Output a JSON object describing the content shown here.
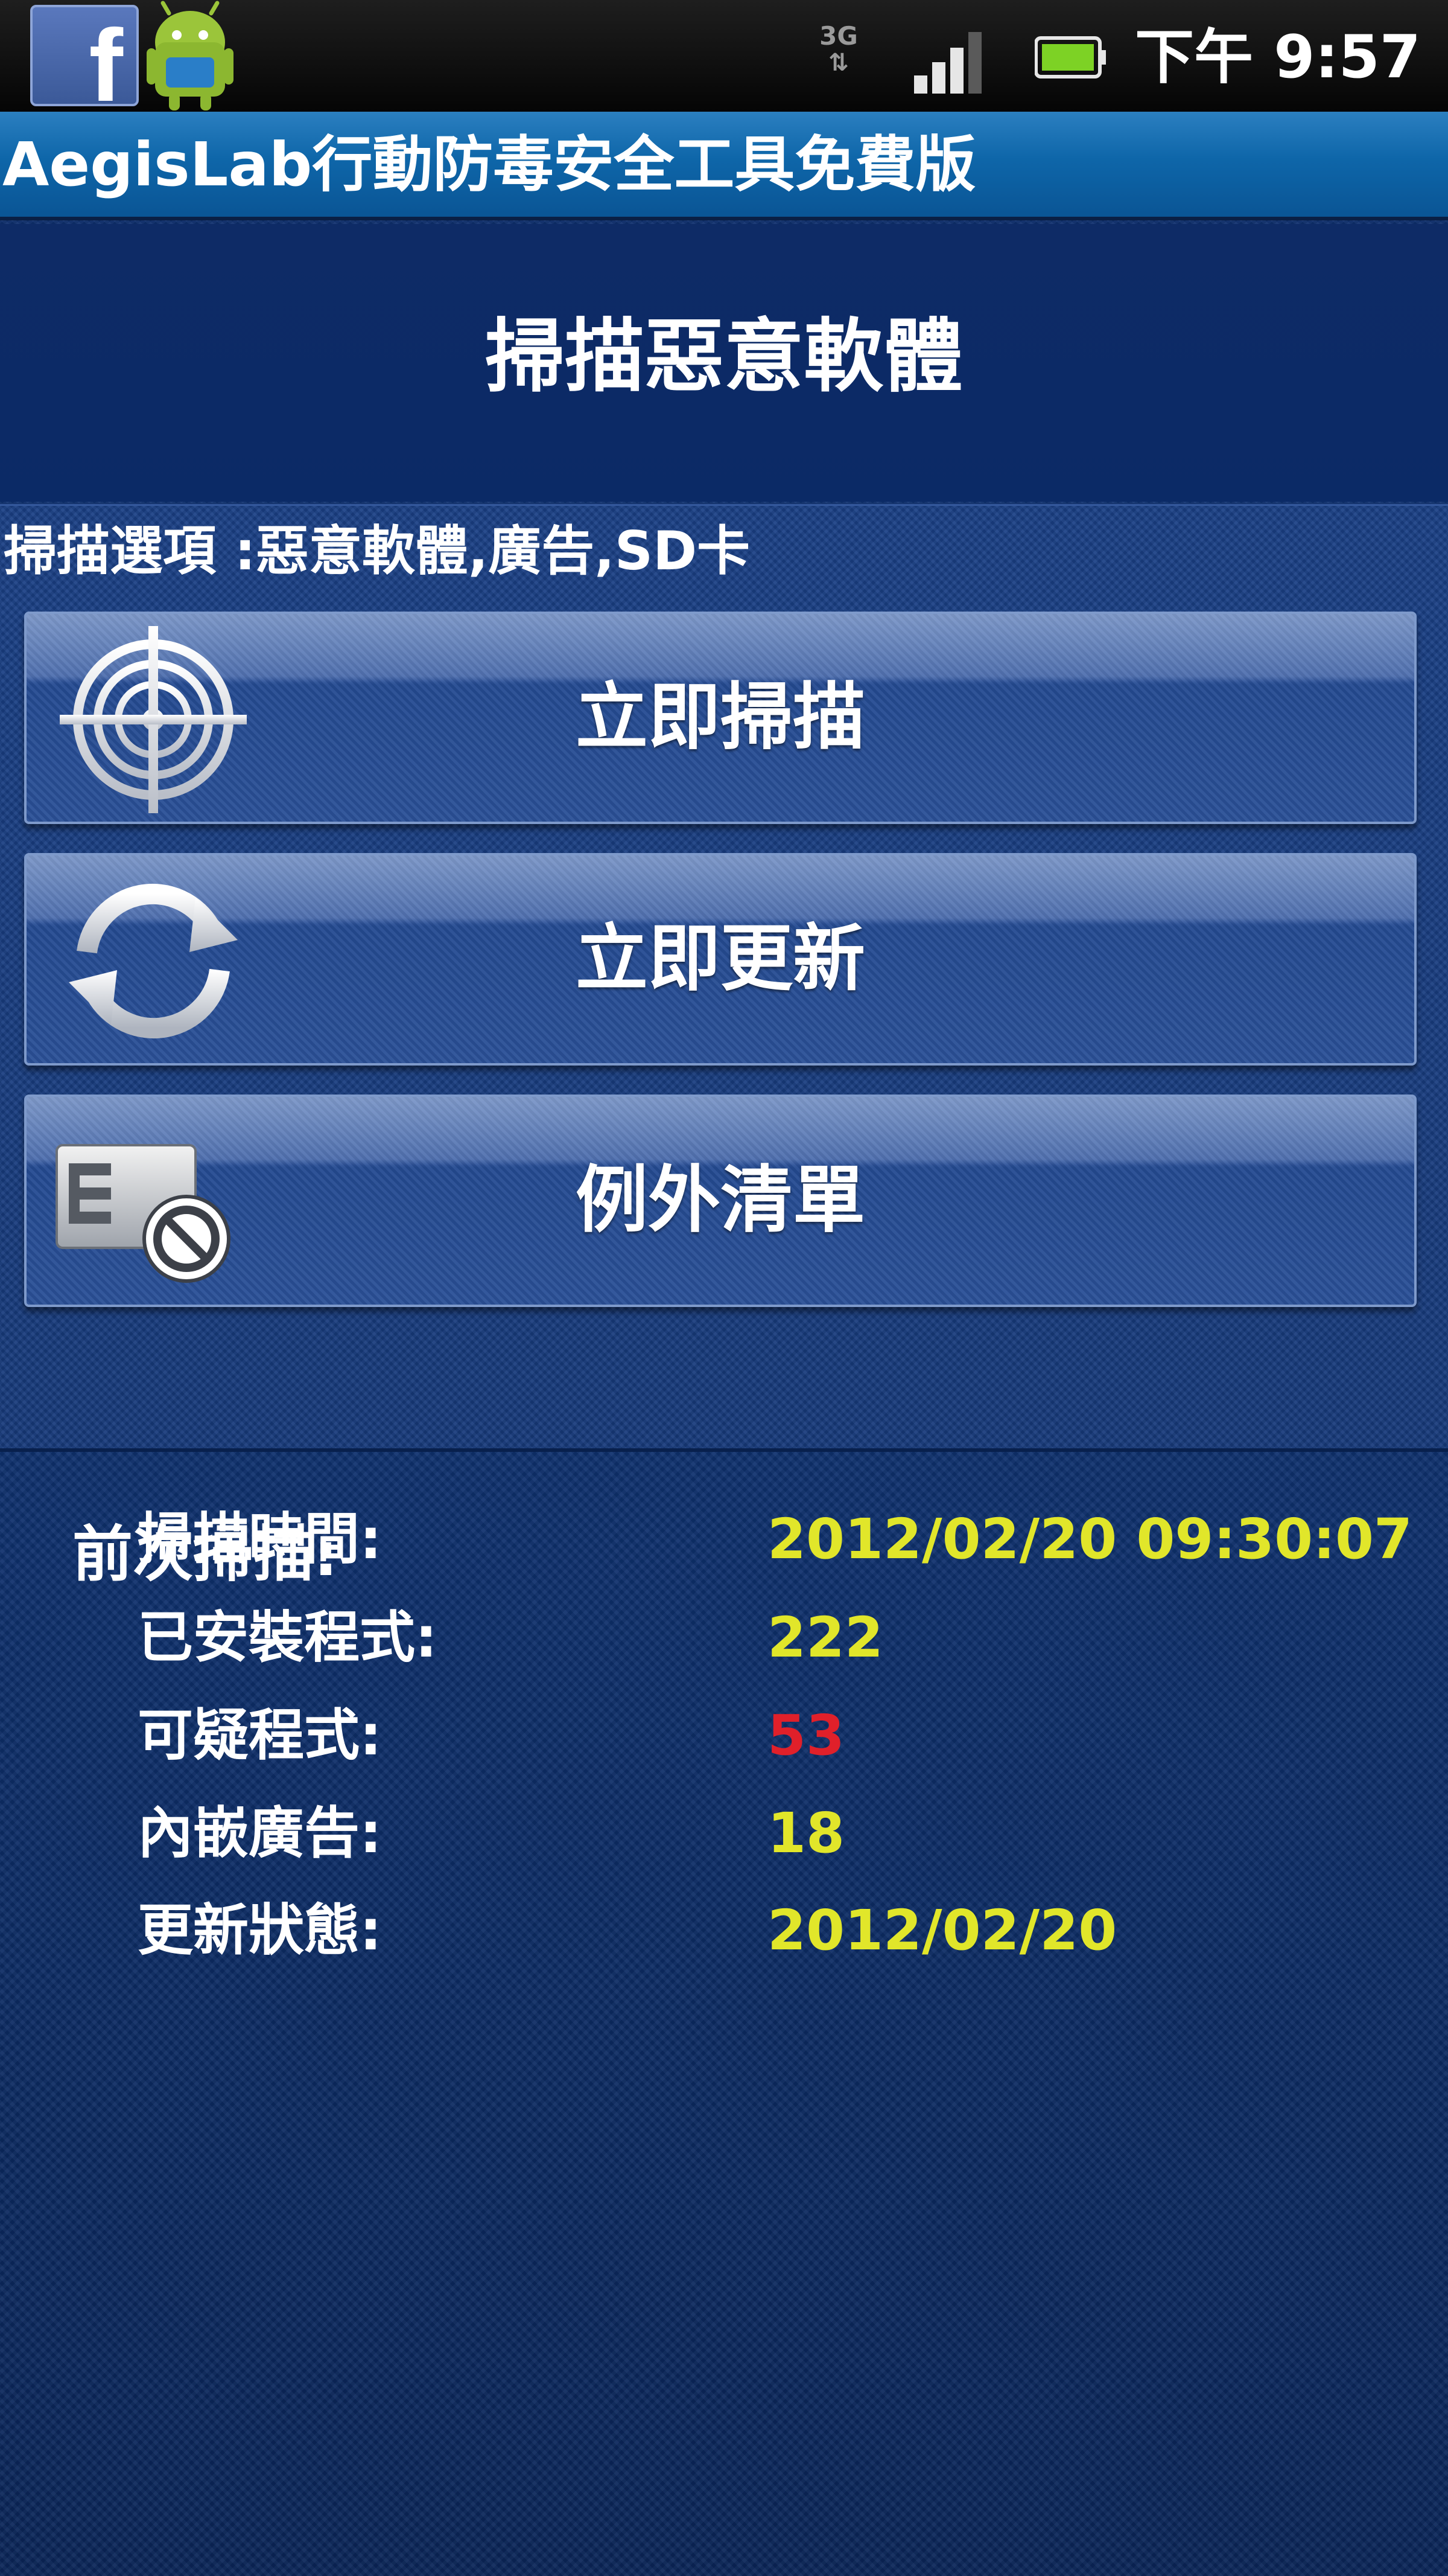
{
  "status_bar": {
    "notification_icons": [
      "facebook-icon",
      "android-icon"
    ],
    "network_type": "3G",
    "clock": "下午 9:57"
  },
  "app": {
    "title": "AegisLab行動防毒安全工具免費版"
  },
  "header": {
    "title": "掃描惡意軟體"
  },
  "scan_options": {
    "text": "掃描選項 :惡意軟體,廣告,SD卡"
  },
  "menu": [
    {
      "label": "立即掃描",
      "icon": "target-icon"
    },
    {
      "label": "立即更新",
      "icon": "refresh-icon"
    },
    {
      "label": "例外清單",
      "icon": "exception-list-icon"
    }
  ],
  "last_scan": {
    "heading": "前次掃描:",
    "rows": [
      {
        "label": "掃描時間:",
        "value": "2012/02/20 09:30:07"
      },
      {
        "label": "已安裝程式:",
        "value": "222"
      },
      {
        "label": "可疑程式:",
        "value": "53"
      },
      {
        "label": "內嵌廣告:",
        "value": "18"
      },
      {
        "label": "更新狀態:",
        "value": "2012/02/20"
      }
    ]
  },
  "colors": {
    "background": "#0c2a63",
    "title_bar": "#0e66a9",
    "value_text": "#e1e62a",
    "alert_value": "#e0202a",
    "button": "#2a5097"
  }
}
